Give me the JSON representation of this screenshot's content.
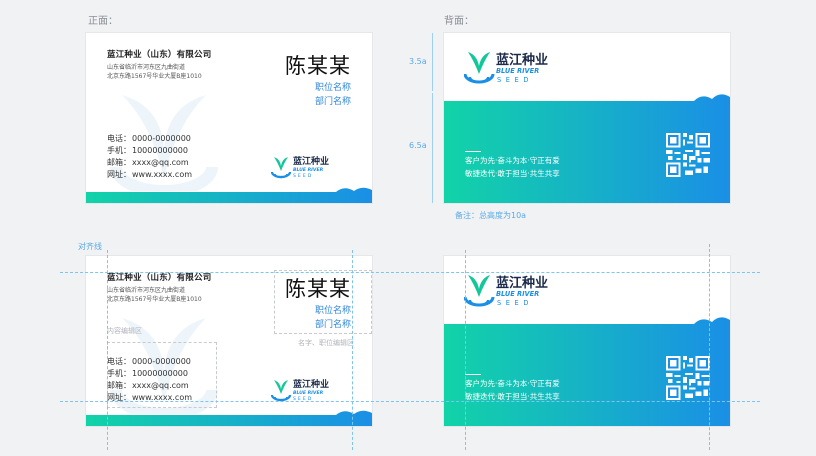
{
  "labels": {
    "front": "正面：",
    "back": "背面：",
    "align_line": "对齐线",
    "content_zone": "内容编辑区",
    "name_zone": "名字、职位编辑区",
    "note": "备注：总高度为10a",
    "dim_top": "3.5a",
    "dim_bottom": "6.5a"
  },
  "card": {
    "company": "蓝江种业（山东）有限公司",
    "addr1": "山东省临沂市河东区九曲街道",
    "addr2": "北京东路1567号华业大厦B座1010",
    "name": "陈某某",
    "position": "职位名称",
    "department": "部门名称",
    "contacts": [
      {
        "key": "电话：",
        "val": "0000-0000000"
      },
      {
        "key": "手机：",
        "val": "10000000000"
      },
      {
        "key": "邮箱：",
        "val": "xxxx@qq.com"
      },
      {
        "key": "网址：",
        "val": "www.xxxx.com"
      }
    ]
  },
  "brand": {
    "cn": "蓝江种业",
    "en1": "BLUE RIVER",
    "en2": "SEED"
  },
  "slogan": {
    "line1": "客户为先·奋斗为本·守正有爱",
    "line2": "敏捷迭代·敢于担当·共生共享"
  },
  "colors": {
    "blue": "#1a8fe6",
    "teal": "#12d3a8",
    "text_blue": "#2f86d9"
  }
}
